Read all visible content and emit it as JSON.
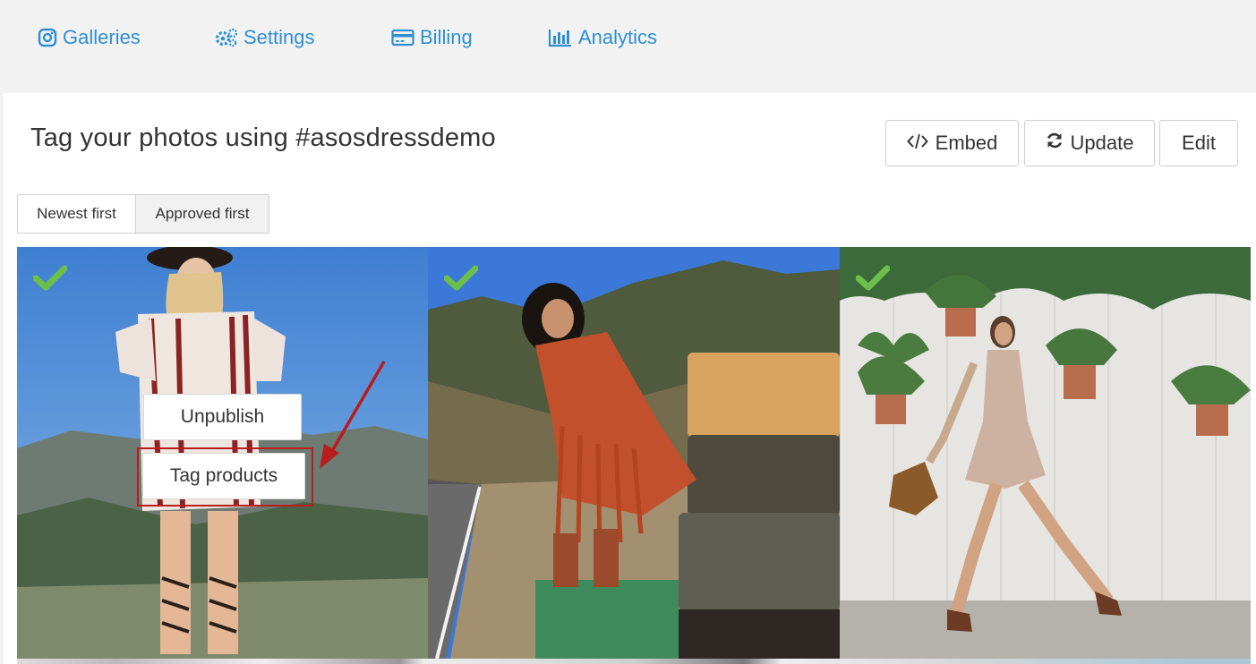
{
  "nav": {
    "items": [
      {
        "label": "Galleries",
        "icon": "instagram-icon"
      },
      {
        "label": "Settings",
        "icon": "gears-icon"
      },
      {
        "label": "Billing",
        "icon": "credit-card-icon"
      },
      {
        "label": "Analytics",
        "icon": "bar-chart-icon"
      }
    ],
    "link_color": "#2f8fd0"
  },
  "header": {
    "title": "Tag your photos using #asosdressdemo"
  },
  "actions": {
    "embed": "Embed",
    "update": "Update",
    "edit": "Edit"
  },
  "sort": {
    "newest": "Newest first",
    "approved": "Approved first",
    "selected": "Approved first"
  },
  "photos": [
    {
      "approved": true,
      "overlay": {
        "unpublish": "Unpublish",
        "tag_products": "Tag products"
      }
    },
    {
      "approved": true
    },
    {
      "approved": true
    }
  ],
  "colors": {
    "approved_check": "#6cc04a",
    "highlight": "#b81c1c"
  }
}
